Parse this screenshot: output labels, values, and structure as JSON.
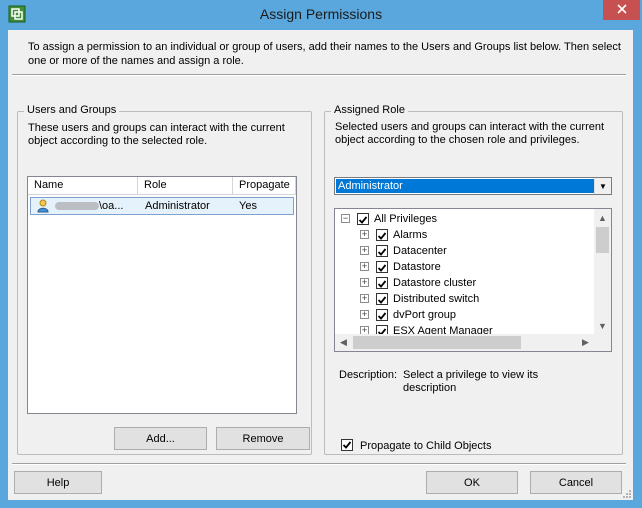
{
  "window": {
    "title": "Assign Permissions"
  },
  "intro_text": "To assign a permission to an individual or group of users, add their names to the Users and Groups list below. Then select one or more of the names and assign a role.",
  "users_groups": {
    "label": "Users and Groups",
    "description": "These users and groups can interact with the current object according to the selected role.",
    "columns": [
      "Name",
      "Role",
      "Propagate"
    ],
    "rows": [
      {
        "name": "\\oa...",
        "role": "Administrator",
        "propagate": "Yes"
      }
    ],
    "add_label": "Add...",
    "remove_label": "Remove"
  },
  "assigned_role": {
    "label": "Assigned Role",
    "description": "Selected users and groups can interact with the current object according to the chosen role and privileges.",
    "selected_role": "Administrator",
    "privileges_root": "All Privileges",
    "privileges": [
      "Alarms",
      "Datacenter",
      "Datastore",
      "Datastore cluster",
      "Distributed switch",
      "dvPort group",
      "ESX Agent Manager"
    ],
    "description_label": "Description:",
    "description_value": "Select a privilege to view its description",
    "propagate_label": "Propagate to Child Objects",
    "propagate_checked": true
  },
  "footer": {
    "help_label": "Help",
    "ok_label": "OK",
    "cancel_label": "Cancel"
  },
  "colors": {
    "titlebar": "#5aa7dd",
    "selection": "#0078d7",
    "close": "#c75050"
  }
}
